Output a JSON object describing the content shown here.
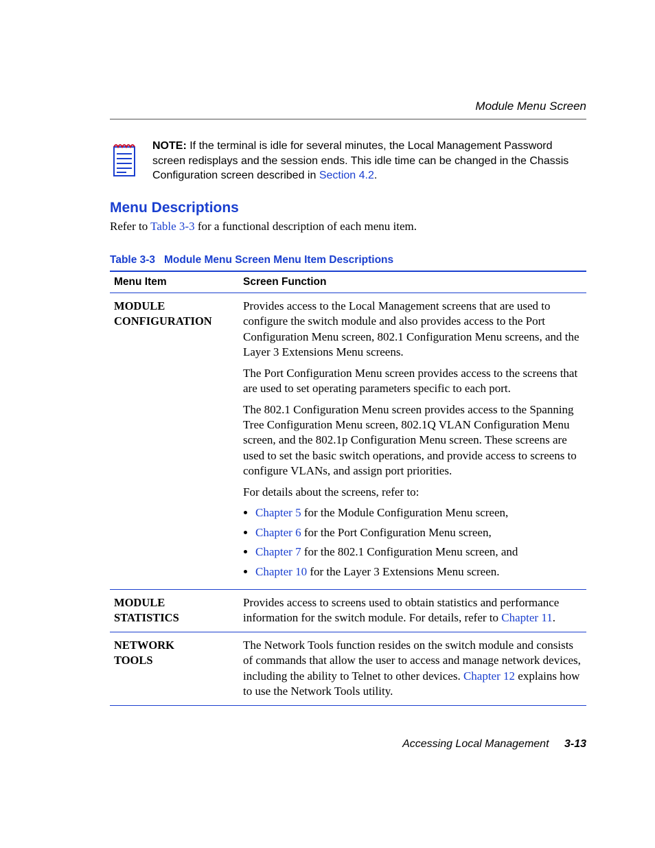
{
  "header": {
    "running_title": "Module Menu Screen"
  },
  "note": {
    "label": "NOTE:",
    "text_before_link": "  If the terminal is idle for several minutes, the Local Management Password screen redisplays and the session ends. This idle time can be changed in the Chassis Configuration screen described in ",
    "link": "Section 4.2",
    "text_after_link": "."
  },
  "section_heading": "Menu Descriptions",
  "intro": {
    "pre": "Refer to ",
    "link": "Table 3-3",
    "post": " for a functional description of each menu item."
  },
  "table": {
    "caption_prefix": "Table 3-3",
    "caption_title": "Module Menu Screen Menu Item Descriptions",
    "col1": "Menu Item",
    "col2": "Screen Function",
    "rows": {
      "r1": {
        "menu_l1": "MODULE",
        "menu_l2": "CONFIGURATION",
        "p1": "Provides access to the Local Management screens that are used to configure the switch module and also provides access to the Port Configuration Menu screen, 802.1 Configuration Menu screens, and the Layer 3 Extensions Menu screens.",
        "p2": "The Port Configuration Menu screen provides access to the screens that are used to set operating parameters specific to each port.",
        "p3": "The 802.1 Configuration Menu screen provides access to the Spanning Tree Configuration Menu screen, 802.1Q VLAN Configuration Menu screen, and the 802.1p Configuration Menu screen. These screens are used to set the basic switch operations, and provide access to screens to configure VLANs, and assign port priorities.",
        "p4": "For details about the screens, refer to:",
        "li1_link": "Chapter 5",
        "li1_rest": " for the Module Configuration Menu screen,",
        "li2_link": "Chapter 6",
        "li2_rest": " for the Port Configuration Menu screen,",
        "li3_link": "Chapter 7",
        "li3_rest": " for the 802.1 Configuration Menu screen, and",
        "li4_link": "Chapter 10",
        "li4_rest": " for the Layer 3 Extensions Menu screen."
      },
      "r2": {
        "menu_l1": "MODULE",
        "menu_l2": "STATISTICS",
        "text_pre": "Provides access to screens used to obtain statistics and performance information for the switch module. For details, refer to ",
        "link": "Chapter 11",
        "text_post": "."
      },
      "r3": {
        "menu_l1": "NETWORK",
        "menu_l2": "TOOLS",
        "text_pre": "The Network Tools function resides on the switch module and consists of commands that allow the user to access and manage network devices, including the ability to Telnet to other devices. ",
        "link": "Chapter 12",
        "text_post": " explains how to use the Network Tools utility."
      }
    }
  },
  "footer": {
    "text": "Accessing Local Management",
    "page": "3-13"
  }
}
